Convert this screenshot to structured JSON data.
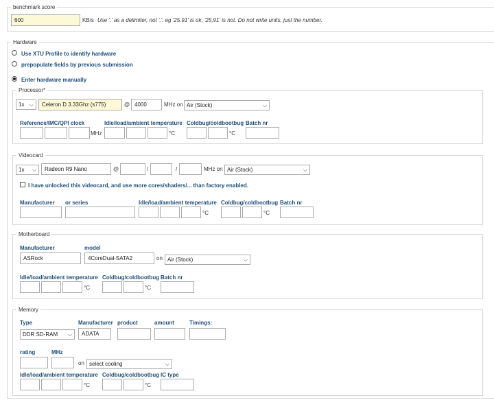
{
  "benchmark": {
    "legend": "benchmark score",
    "score_value": "600",
    "unit": "KB/s",
    "hint": "Use '.' as a delimiter, not ','. eg '25.91' is ok, '25,91' is not. Do not write units, just the number."
  },
  "hardware": {
    "legend": "Hardware",
    "options": [
      {
        "label": "Use XTU Profile to identify hardware",
        "checked": false
      },
      {
        "label": "prepopulate fields by previous submission",
        "checked": false
      },
      {
        "label": "Enter hardware manually",
        "checked": true
      }
    ]
  },
  "processor": {
    "legend": "Processor*",
    "count": "1x",
    "model": "Celeron D 3.33Ghz (s775)",
    "at": "@",
    "mhz_value": "4000",
    "mhz_on": "MHz on",
    "cooling": "Air (Stock)",
    "col_ref": "Reference/IMC/QPI clock",
    "col_temp": "Idle/load/ambient temperature",
    "col_cold": "Coldbug/coldbootbug",
    "col_batch": "Batch nr",
    "unit_mhz": "MHz",
    "unit_c": "°C"
  },
  "videocard": {
    "legend": "Videocard",
    "count": "1x",
    "model": "Radeon R9 Nano",
    "at": "@",
    "slash": "/",
    "mhz_on": "MHz on",
    "cooling": "Air (Stock)",
    "unlocked_label": "I have unlocked this videocard, and use more cores/shaders/... than factory enabled.",
    "col_manufacturer": "Manufacturer",
    "col_series": "or series",
    "col_temp": "Idle/load/ambient temperature",
    "col_cold": "Coldbug/coldbootbug",
    "col_batch": "Batch nr",
    "unit_c": "°C"
  },
  "motherboard": {
    "legend": "Motherboard",
    "col_manufacturer": "Manufacturer",
    "col_model": "model",
    "manufacturer": "ASRock",
    "model": "4CoreDual-SATA2",
    "on": "on",
    "cooling": "Air (Stock)",
    "col_temp": "Idle/load/ambient temperature",
    "col_cold": "Coldbug/coldbootbug",
    "col_batch": "Batch nr",
    "unit_c": "°C"
  },
  "memory": {
    "legend": "Memory",
    "col_type": "Type",
    "col_manufacturer": "Manufacturer",
    "col_product": "product",
    "col_amount": "amount",
    "col_timings": "Timings:",
    "type": "DDR SD-RAM",
    "manufacturer": "ADATA",
    "col_rating": "rating",
    "col_mhz": "MHz",
    "on": "on",
    "cooling": "select cooling",
    "col_temp": "Idle/load/ambient temperature",
    "col_cold": "Coldbug/coldbootbug",
    "col_ic": "IC type",
    "unit_c": "°C"
  }
}
